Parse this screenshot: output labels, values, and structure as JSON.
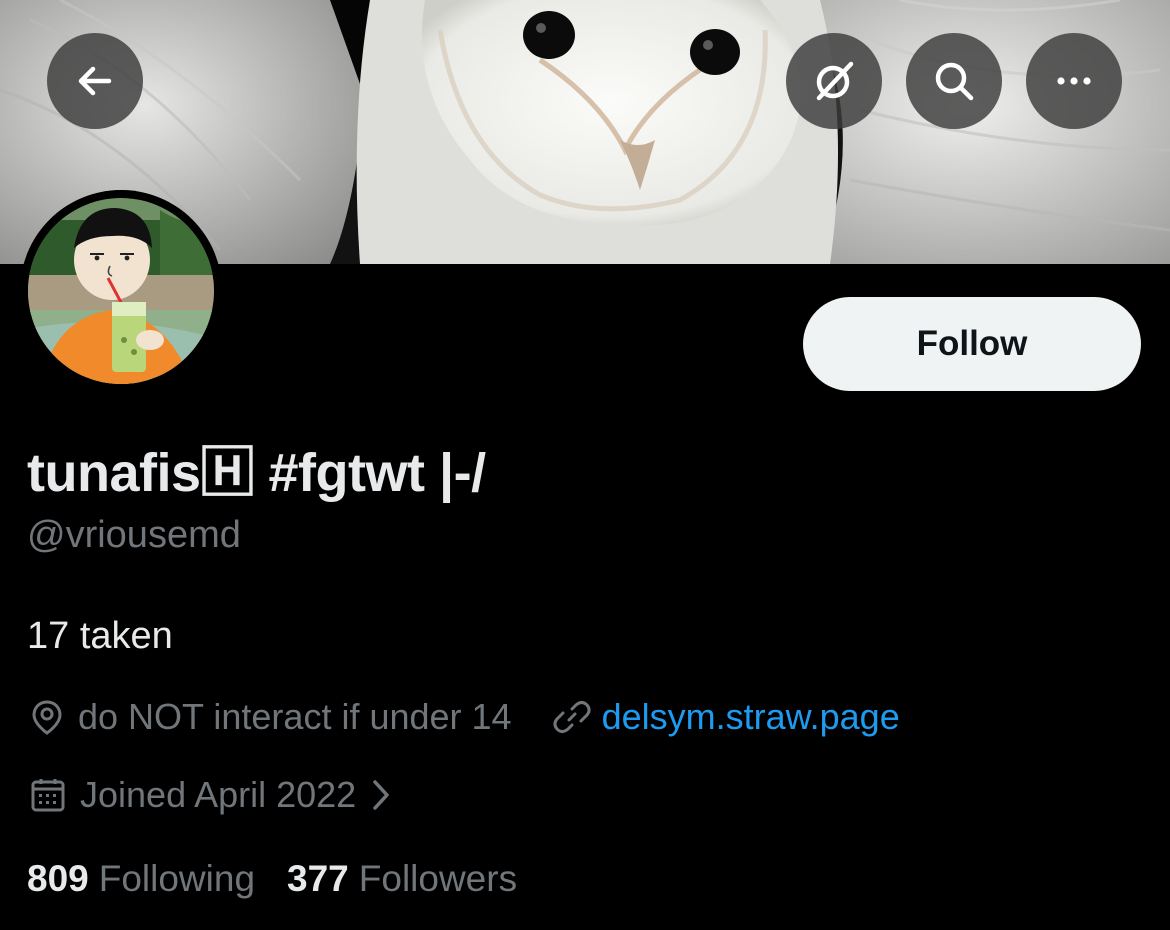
{
  "header": {
    "back_icon": "arrow-left-icon",
    "grok_icon": "grok-icon",
    "search_icon": "search-icon",
    "more_icon": "more-horizontal-icon"
  },
  "profile": {
    "display_name": "tunafis🄷 #fgtwt |-/",
    "handle": "@vriousemd",
    "bio": "17 taken",
    "location": "do NOT interact if under 14",
    "website": "delsym.straw.page",
    "joined": "Joined April 2022",
    "follow_label": "Follow"
  },
  "stats": {
    "following_count": "809",
    "following_label": "Following",
    "followers_count": "377",
    "followers_label": "Followers"
  },
  "colors": {
    "background": "#000000",
    "text_primary": "#e7e9ea",
    "text_secondary": "#71767b",
    "link": "#1d9bf0",
    "follow_button_bg": "#eff3f4"
  }
}
